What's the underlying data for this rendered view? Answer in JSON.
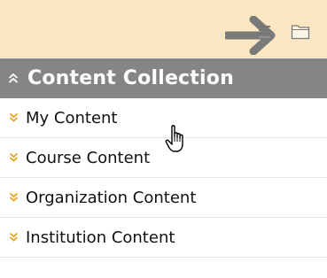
{
  "toolbar": {
    "background": "#fce7c2",
    "icons": [
      "arrow-right-icon",
      "list-view-icon",
      "folder-icon"
    ]
  },
  "content_collection": {
    "title": "Content Collection",
    "icon": "chevron-up-double-icon",
    "header_color": "#858585",
    "items": [
      {
        "label": "My Content",
        "icon": "chevron-down-double-icon"
      },
      {
        "label": "Course Content",
        "icon": "chevron-down-double-icon"
      },
      {
        "label": "Organization Content",
        "icon": "chevron-down-double-icon"
      },
      {
        "label": "Institution Content",
        "icon": "chevron-down-double-icon"
      }
    ],
    "chevron_color": "#e8a323"
  },
  "cursor": {
    "icon": "hand-pointer-icon"
  }
}
